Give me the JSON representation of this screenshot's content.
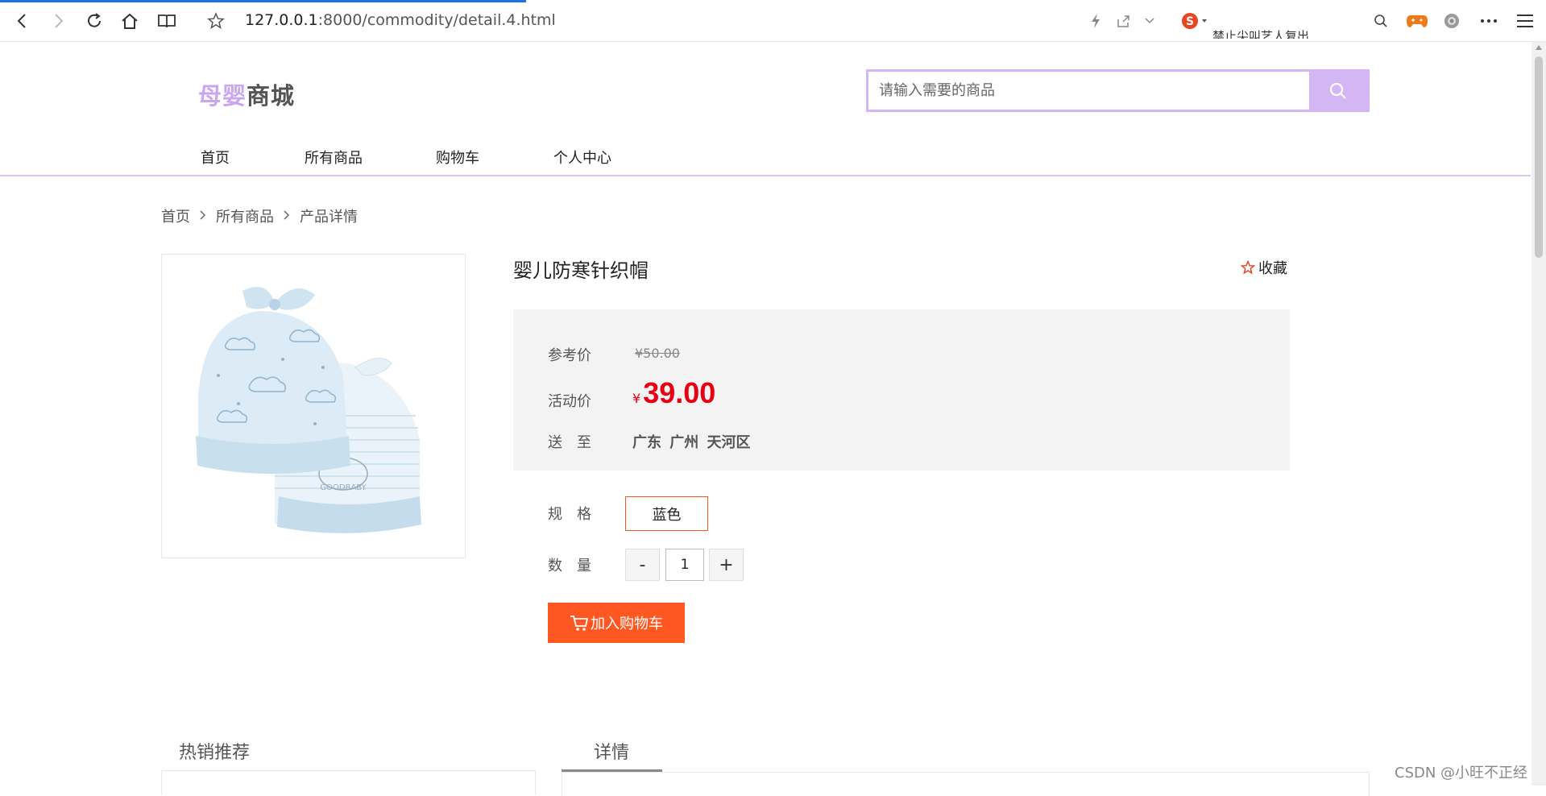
{
  "browser": {
    "url_host": "127.0.0.1",
    "url_rest": ":8000/commodity/detail.4.html",
    "sogou_text": "禁止尖叫艺人复出"
  },
  "header": {
    "logo_part1": "母婴",
    "logo_part2": "商城",
    "search_placeholder": "请输入需要的商品"
  },
  "nav": {
    "items": [
      {
        "label": "首页"
      },
      {
        "label": "所有商品"
      },
      {
        "label": "购物车"
      },
      {
        "label": "个人中心"
      }
    ]
  },
  "breadcrumb": {
    "items": [
      "首页",
      "所有商品",
      "产品详情"
    ]
  },
  "product": {
    "title": "婴儿防寒针织帽",
    "collect_label": "收藏",
    "ref_price_label": "参考价",
    "ref_price": "¥50.00",
    "act_price_label": "活动价",
    "currency": "¥",
    "act_price": "39.00",
    "ship_label": "送　至",
    "ship_to": "广东 广州 天河区",
    "spec_label": "规　格",
    "spec_value": "蓝色",
    "qty_label": "数　量",
    "qty_minus": "-",
    "qty_plus": "+",
    "qty_value": "1",
    "add_cart_label": "加入购物车"
  },
  "bottom": {
    "hot_tab": "热销推荐",
    "detail_tab": "详情",
    "watermark": "CSDN @小旺不正经"
  },
  "colors": {
    "accent_purple": "#d5b6f5",
    "price_red": "#e60012",
    "cart_orange": "#ff5722"
  }
}
